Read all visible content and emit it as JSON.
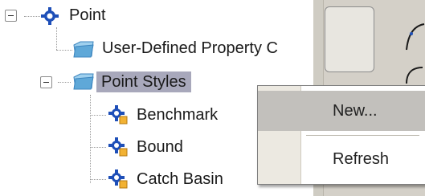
{
  "tree": {
    "root": {
      "label": "Point",
      "icon": "point-gear-icon"
    },
    "items": [
      {
        "label": "User-Defined Property C",
        "icon": "folder-icon"
      },
      {
        "label": "Point Styles",
        "icon": "folder-icon",
        "selected": true
      }
    ],
    "children": [
      {
        "label": "Benchmark",
        "icon": "point-style-icon"
      },
      {
        "label": "Bound",
        "icon": "point-style-icon"
      },
      {
        "label": "Catch Basin",
        "icon": "point-style-icon"
      }
    ]
  },
  "context_menu": {
    "items": [
      {
        "label": "New...",
        "highlighted": true
      },
      {
        "label": "Refresh",
        "highlighted": false
      }
    ]
  },
  "colors": {
    "selection": "#a8a8bb",
    "menu_highlight": "#c2c0bc",
    "folder": "#5fa8d8",
    "point_icon": "#1e4fb8"
  }
}
